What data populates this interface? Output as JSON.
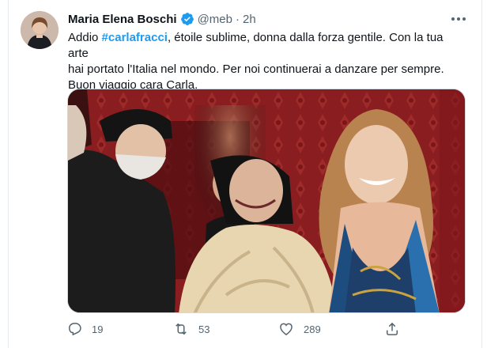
{
  "tweet": {
    "author_name": "Maria Elena Boschi",
    "handle": "@meb",
    "separator": "·",
    "time": "2h",
    "text_prefix": "Addio ",
    "hashtag": "#carlafracci",
    "text_rest_line1": ", étoile sublime, donna dalla forza gentile. Con la tua arte",
    "text_line2": "hai portato l'Italia nel mondo. Per noi continuerai a danzare per sempre.",
    "text_line3": "Buon viaggio cara Carla."
  },
  "actions": {
    "reply_count": "19",
    "retweet_count": "53",
    "like_count": "289"
  },
  "colors": {
    "accent": "#1d9bf0",
    "text": "#0f1419",
    "secondary": "#536471"
  }
}
